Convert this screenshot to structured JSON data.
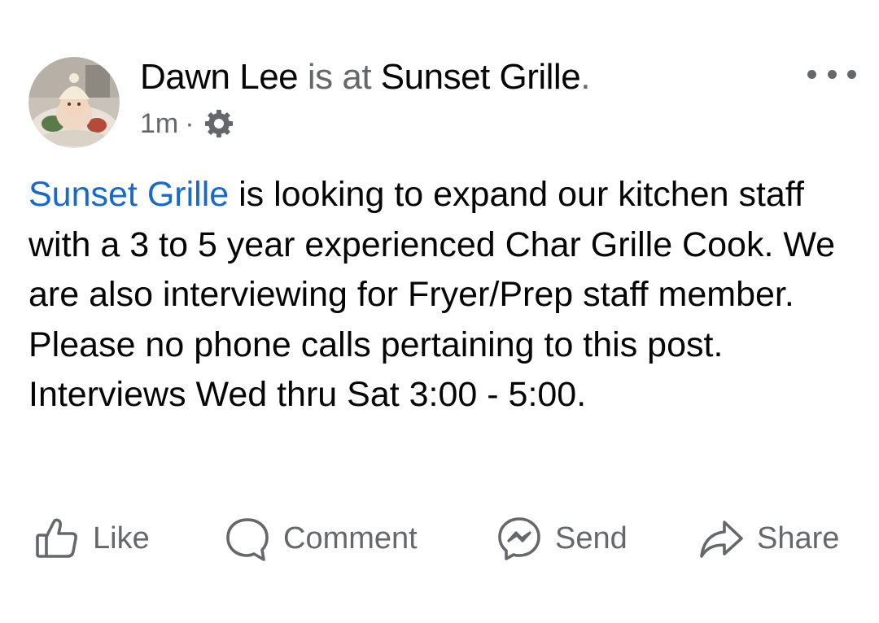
{
  "post": {
    "author": "Dawn Lee",
    "connector": " is at ",
    "place": "Sunset Grille",
    "period": ".",
    "timestamp": "1m",
    "separator": "·",
    "privacy_icon": "gear-icon",
    "more_icon": "more-horizontal-icon",
    "body": {
      "page_link": "Sunset Grille",
      "text": " is looking to expand our kitchen staff with a 3 to 5 year experienced Char Grille Cook. We are also interviewing for Fryer/Prep staff member. Please no phone calls pertaining to this post. Interviews Wed thru Sat 3:00 - 5:00."
    }
  },
  "actions": {
    "like": {
      "label": "Like",
      "icon": "thumbs-up-icon"
    },
    "comment": {
      "label": "Comment",
      "icon": "comment-bubble-icon"
    },
    "send": {
      "label": "Send",
      "icon": "messenger-icon"
    },
    "share": {
      "label": "Share",
      "icon": "share-arrow-icon"
    }
  },
  "colors": {
    "link": "#1869c8",
    "text": "#050505",
    "secondary": "#65676b"
  }
}
